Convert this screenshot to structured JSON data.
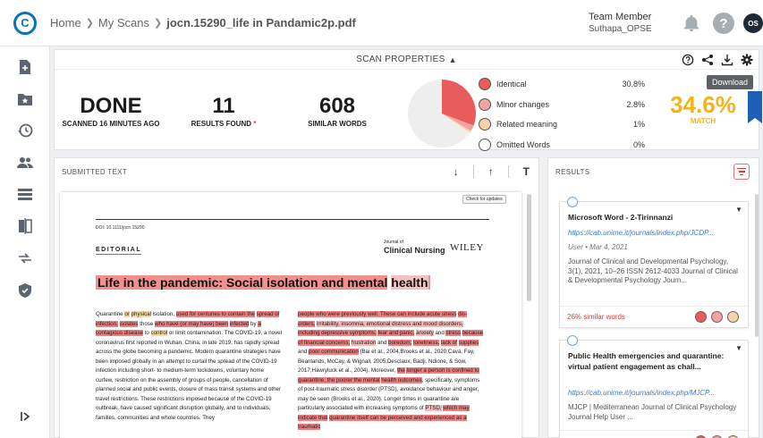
{
  "app": {
    "logo_letter": "C"
  },
  "breadcrumb": {
    "home": "Home",
    "scans": "My Scans",
    "file": "jocn.15290_life in Pandamic2p.pdf"
  },
  "user": {
    "role": "Team Member",
    "name": "Suthapa_OPSE",
    "initials": "OS"
  },
  "sidebar": {
    "icons": [
      "add-file-icon",
      "folder-star-icon",
      "history-icon",
      "users-icon",
      "list-icon",
      "compare-icon",
      "integrations-icon",
      "shield-icon",
      "expand-icon"
    ]
  },
  "scan_properties": {
    "header": "SCAN PROPERTIES",
    "status": {
      "value": "DONE",
      "label": "SCANNED 16 MINUTES AGO"
    },
    "results": {
      "value": "11",
      "label": "RESULTS FOUND",
      "star": "*"
    },
    "similar": {
      "value": "608",
      "label": "SIMILAR WORDS"
    },
    "legend": [
      {
        "label": "Identical",
        "value": "30.8%",
        "color": "#e95c5c"
      },
      {
        "label": "Minor changes",
        "value": "2.8%",
        "color": "#f1a3a3"
      },
      {
        "label": "Related meaning",
        "value": "1%",
        "color": "#f6d3a6"
      },
      {
        "label": "Omitted Words",
        "value": "0%",
        "color": "#ffffff"
      }
    ],
    "match": {
      "value": "34.6%",
      "label": "MATCH"
    },
    "tooltip": "Download",
    "pie_fractions": {
      "identical": 0.308,
      "minor": 0.028,
      "related": 0.01
    }
  },
  "submitted": {
    "header": "SUBMITTED TEXT",
    "check_updates": "Check for updates",
    "doi": "DOI: 10.1111/jocn.15290",
    "section": "EDITORIAL",
    "journal_small": "Journal of",
    "journal_name": "Clinical Nursing",
    "publisher": "WILEY",
    "title_parts": [
      "Life in the pandemic: Social isolation and mental",
      "health"
    ]
  },
  "results": {
    "header": "RESULTS",
    "cards": [
      {
        "title": "Microsoft Word - 2-Tirinnanzi",
        "link": "https://cab.unime.it/journals/index.php/JCDP...",
        "meta": "User • Mar 4, 2021",
        "desc": "Journal of Clinical and Developmental Psychology, 3(1), 2021, 10–26 ISSN 2612-4033 Journal of Clinical & Developmental Psychology Journ...",
        "similar": "26% similar words"
      },
      {
        "title": "Public Health emergencies and quarantine: virtual patient engagement as chall...",
        "link": "https://cab.unime.it/journals/index.php/MJCP...",
        "meta": "",
        "desc": "MJCP | Mediterranean Journal of Clinical Psychology Journal Help User ...",
        "similar": ""
      }
    ]
  }
}
